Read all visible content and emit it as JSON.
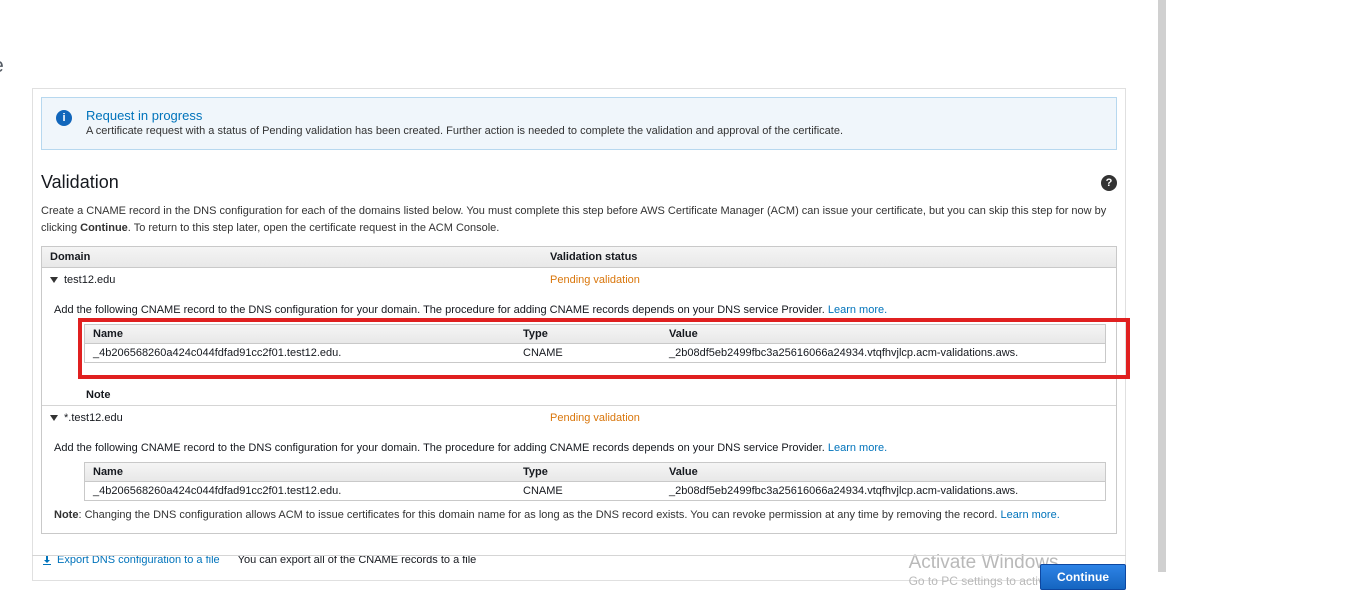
{
  "page": {
    "cut_title": "ate"
  },
  "banner": {
    "title": "Request in progress",
    "text": "A certificate request with a status of Pending validation has been created. Further action is needed to complete the validation and approval of the certificate."
  },
  "validation": {
    "heading": "Validation",
    "description_pre": "Create a CNAME record in the DNS configuration for each of the domains listed below. You must complete this step before AWS Certificate Manager (ACM) can issue your certificate, but you can skip this step for now by clicking ",
    "description_bold": "Continue",
    "description_post": ". To return to this step later, open the certificate request in the ACM Console.",
    "columns": {
      "domain": "Domain",
      "status": "Validation status"
    },
    "cname_columns": {
      "name": "Name",
      "type": "Type",
      "value": "Value"
    },
    "instruction_pre": "Add the following CNAME record to the DNS configuration for your domain. The procedure for adding CNAME records depends on your DNS service Provider. ",
    "learn_more": "Learn more.",
    "note_label": "Note",
    "note_text": ": Changing the DNS configuration allows ACM to issue certificates for this domain name for as long as the DNS record exists. You can revoke permission at any time by removing the record. ",
    "domains": [
      {
        "name": "test12.edu",
        "status": "Pending validation",
        "cname": {
          "name": "_4b206568260a424c044fdfad91cc2f01.test12.edu.",
          "type": "CNAME",
          "value": "_2b08df5eb2499fbc3a25616066a24934.vtqfhvjlcp.acm-validations.aws."
        },
        "highlighted": true
      },
      {
        "name": "*.test12.edu",
        "status": "Pending validation",
        "cname": {
          "name": "_4b206568260a424c044fdfad91cc2f01.test12.edu.",
          "type": "CNAME",
          "value": "_2b08df5eb2499fbc3a25616066a24934.vtqfhvjlcp.acm-validations.aws."
        },
        "highlighted": false
      }
    ],
    "export_link": "Export DNS configuration to a file",
    "export_hint": "You can export all of the CNAME records to a file"
  },
  "footer": {
    "continue": "Continue"
  },
  "watermark": {
    "title": "Activate Windows",
    "sub": "Go to PC settings to activate Windows."
  }
}
